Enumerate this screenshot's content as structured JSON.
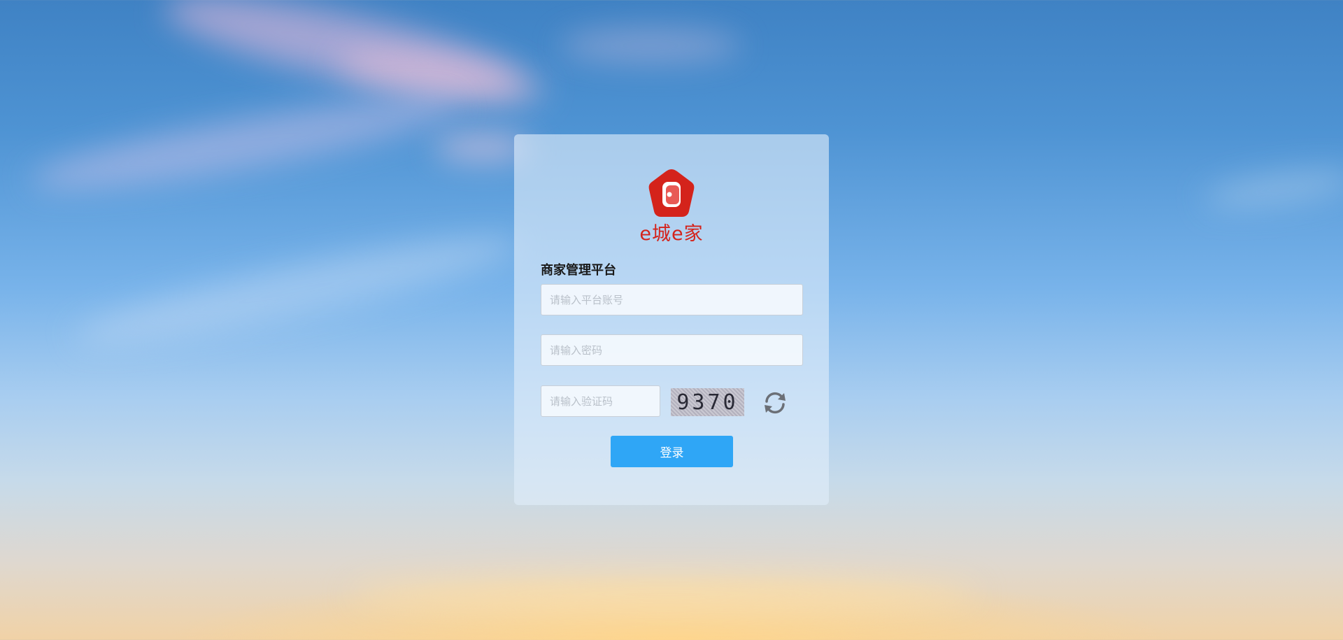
{
  "brand": {
    "name": "e城e家",
    "logo_icon": "house-badge-icon",
    "color": "#d4231b"
  },
  "login": {
    "title": "商家管理平台",
    "account_placeholder": "请输入平台账号",
    "account_value": "",
    "password_placeholder": "请输入密码",
    "password_value": "",
    "captcha_placeholder": "请输入验证码",
    "captcha_value": "",
    "captcha_code": "9370",
    "refresh_icon": "refresh-icon",
    "submit_label": "登录",
    "accent": "#2fa6f6"
  }
}
